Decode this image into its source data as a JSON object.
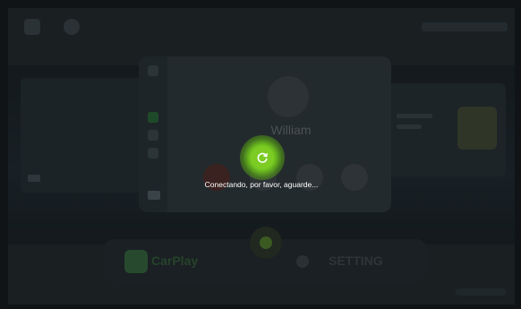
{
  "status": {
    "message": "Conectando, por favor, aguarde..."
  },
  "contact": {
    "name": "William"
  },
  "dock": {
    "carplay_label": "CarPlay",
    "setting_label": "SETTING"
  },
  "colors": {
    "spinner": "#7ccc24",
    "overlay": "#101416"
  },
  "icons": {
    "spinner": "refresh-icon",
    "home": "home-icon",
    "settings": "gear-icon"
  }
}
